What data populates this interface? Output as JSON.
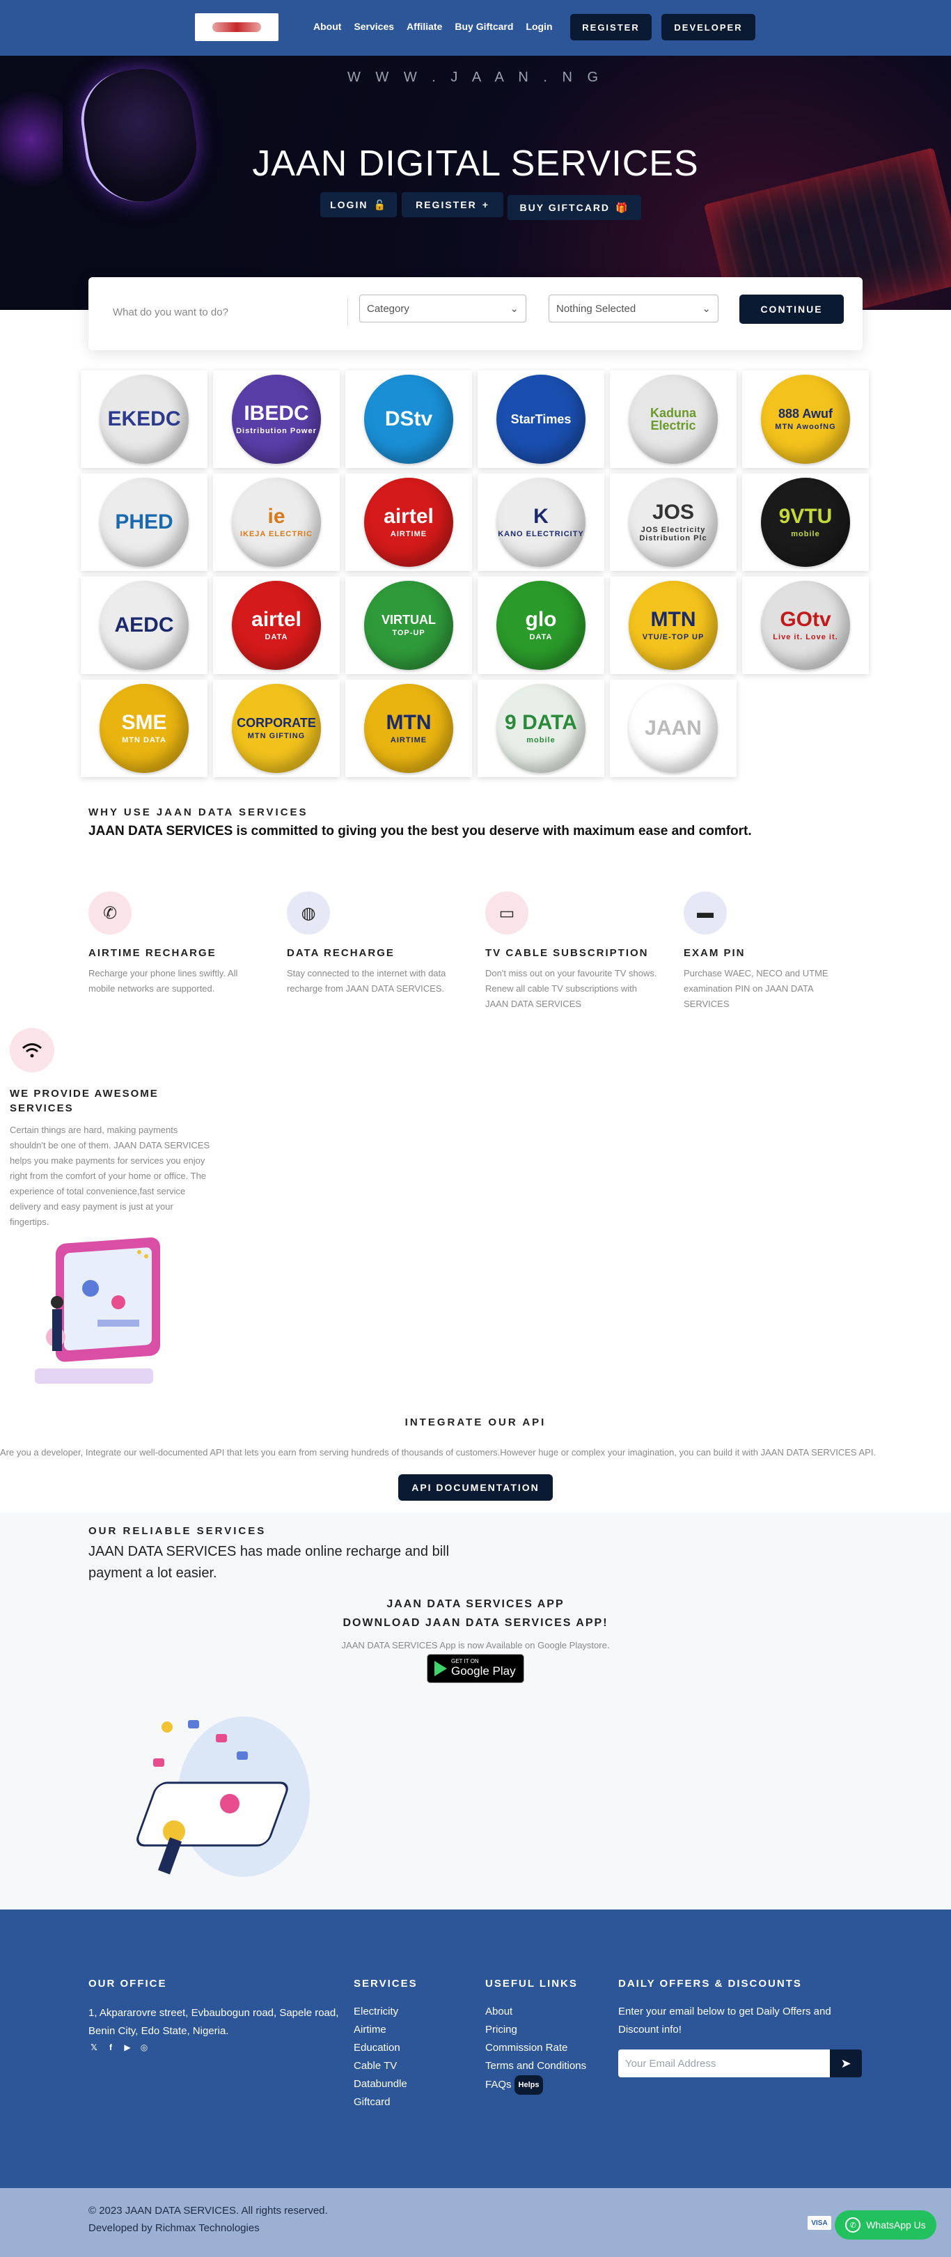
{
  "nav": {
    "links": [
      "About",
      "Services",
      "Affiliate",
      "Buy Giftcard",
      "Login"
    ],
    "register_label": "REGISTER",
    "developer_label": "DEVELOPER"
  },
  "hero": {
    "url": "W W W . J A A N . N G",
    "title": "JAAN DIGITAL SERVICES",
    "login_label": "LOGIN",
    "register_label": "REGISTER",
    "giftcard_label": "BUY GIFTCARD"
  },
  "search": {
    "placeholder": "What do you want to do?",
    "category_value": "Category",
    "selected_value": "Nothing Selected",
    "continue_label": "CONTINUE"
  },
  "services": [
    {
      "main": "EKEDC",
      "sub": "",
      "bg": "#e8e8e8",
      "color": "#2b3a8c"
    },
    {
      "main": "IBEDC",
      "sub": "Distribution Power",
      "bg": "#5a3ea8",
      "color": "#ffffff"
    },
    {
      "main": "DStv",
      "sub": "",
      "bg": "#1a8fd6",
      "color": "#ffffff"
    },
    {
      "main": "StarTimes",
      "sub": "",
      "bg": "#1a4fb0",
      "color": "#ffffff"
    },
    {
      "main": "Kaduna Electric",
      "sub": "",
      "bg": "#e6e6e6",
      "color": "#6a9a2a"
    },
    {
      "main": "888 Awuf",
      "sub": "MTN AwoofNG",
      "bg": "#f4c21c",
      "color": "#1b2a6b"
    },
    {
      "main": "PHED",
      "sub": "",
      "bg": "#ececec",
      "color": "#1a6ab0"
    },
    {
      "main": "ie",
      "sub": "IKEJA ELECTRIC",
      "bg": "#ececec",
      "color": "#d97a1a"
    },
    {
      "main": "airtel",
      "sub": "AIRTIME",
      "bg": "#d41a1a",
      "color": "#ffffff"
    },
    {
      "main": "K",
      "sub": "KANO ELECTRICITY",
      "bg": "#ececec",
      "color": "#1b2a6b"
    },
    {
      "main": "JOS",
      "sub": "JOS Electricity Distribution Plc",
      "bg": "#ececec",
      "color": "#333333"
    },
    {
      "main": "9VTU",
      "sub": "mobile",
      "bg": "#1a1a1a",
      "color": "#c6d93a"
    },
    {
      "main": "AEDC",
      "sub": "",
      "bg": "#ececec",
      "color": "#1b2a6b"
    },
    {
      "main": "airtel",
      "sub": "DATA",
      "bg": "#d41a1a",
      "color": "#ffffff"
    },
    {
      "main": "VIRTUAL",
      "sub": "TOP-UP",
      "bg": "#2f9a3a",
      "color": "#ffffff"
    },
    {
      "main": "glo",
      "sub": "DATA",
      "bg": "#2a9a2a",
      "color": "#ffffff"
    },
    {
      "main": "MTN",
      "sub": "VTU/E-TOP UP",
      "bg": "#f4c21c",
      "color": "#1b2a6b"
    },
    {
      "main": "GOtv",
      "sub": "Live it. Love it.",
      "bg": "#e0e0e0",
      "color": "#c21a1a"
    },
    {
      "main": "SME",
      "sub": "MTN DATA",
      "bg": "#e9b410",
      "color": "#ffffff"
    },
    {
      "main": "CORPORATE",
      "sub": "MTN GIFTING",
      "bg": "#f1c21c",
      "color": "#1b2a6b"
    },
    {
      "main": "MTN",
      "sub": "AIRTIME",
      "bg": "#e9b410",
      "color": "#1b2a6b"
    },
    {
      "main": "9 DATA",
      "sub": "mobile",
      "bg": "#e8efe8",
      "color": "#2a8a3a"
    },
    {
      "main": "JAAN",
      "sub": "",
      "bg": "#ffffff",
      "color": "#bbbbbb"
    }
  ],
  "why": {
    "kicker": "WHY USE JAAN DATA SERVICES",
    "headline": "JAAN DATA SERVICES is committed to giving you the best you deserve with maximum ease and comfort."
  },
  "features": [
    {
      "title": "AIRTIME RECHARGE",
      "text": "Recharge your phone lines swiftly. All mobile networks are supported.",
      "icon": "phone-icon",
      "glyph": "✆",
      "bg": "#fbe3ea",
      "color": "#1b1f3a"
    },
    {
      "title": "DATA RECHARGE",
      "text": "Stay connected to the internet with data recharge from JAAN DATA SERVICES.",
      "icon": "globe-icon",
      "glyph": "◍",
      "bg": "#e6e8f6",
      "color": "#1b1f3a"
    },
    {
      "title": "TV CABLE SUBSCRIPTION",
      "text": "Don't miss out on your favourite TV shows. Renew all cable TV subscriptions with JAAN DATA SERVICES",
      "icon": "tv-icon",
      "glyph": "▭",
      "bg": "#fbe3ea",
      "color": "#1b1f3a"
    },
    {
      "title": "EXAM PIN",
      "text": "Purchase WAEC, NECO and UTME examination PIN on JAAN DATA SERVICES",
      "icon": "card-icon",
      "glyph": "▬",
      "bg": "#e6e8f6",
      "color": "#1b1f3a"
    }
  ],
  "awesome": {
    "title": "WE PROVIDE AWESOME SERVICES",
    "text": "Certain things are hard, making payments shouldn't be one of them. JAAN DATA SERVICES helps you make payments for services you enjoy right from the comfort of your home or office. The experience of total convenience,fast service delivery and easy payment is just at your fingertips."
  },
  "api": {
    "title": "INTEGRATE OUR API",
    "text": "Are you a developer, Integrate our well-documented API that lets you earn from serving hundreds of thousands of customers.However huge or complex your imagination, you can build it with JAAN DATA SERVICES API.",
    "button_label": "API DOCUMENTATION"
  },
  "reliable": {
    "kicker": "OUR RELIABLE SERVICES",
    "headline": "JAAN DATA SERVICES has made online recharge and bill payment a lot easier.",
    "app_title": "JAAN DATA SERVICES APP",
    "app_subtitle": "DOWNLOAD JAAN DATA SERVICES APP!",
    "app_text": "JAAN DATA SERVICES App is now Available on Google Playstore.",
    "gplay_small": "GET IT ON",
    "gplay_big": "Google Play"
  },
  "footer": {
    "office_title": "OUR OFFICE",
    "office_address": "1, Akpararovre street, Evbaubogun road, Sapele road, Benin City, Edo State, Nigeria.",
    "services_title": "SERVICES",
    "services": [
      "Electricity",
      "Airtime",
      "Education",
      "Cable TV",
      "Databundle",
      "Giftcard"
    ],
    "links_title": "USEFUL LINKS",
    "links": [
      "About",
      "Pricing",
      "Commission Rate",
      "Terms and Conditions",
      "FAQs"
    ],
    "faqs_badge": "Helps",
    "daily_title": "DAILY OFFERS & DISCOUNTS",
    "daily_text": "Enter your email below to get Daily Offers and Discount info!",
    "email_placeholder": "Your Email Address",
    "copyright": "© 2023 JAAN DATA SERVICES. All rights reserved.",
    "developer": "Developed by Richmax Technologies",
    "visa": "VISA",
    "whatsapp_label": "WhatsApp Us"
  }
}
